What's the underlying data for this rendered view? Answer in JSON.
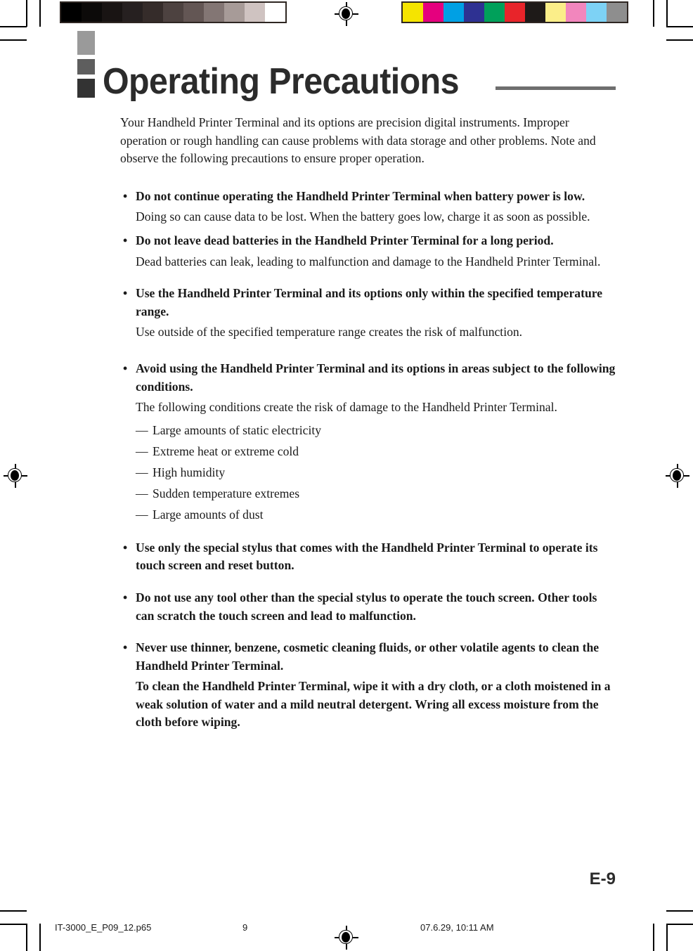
{
  "document": {
    "title": "Operating Precautions",
    "folio": "E-9"
  },
  "intro": "Your Handheld Printer Terminal and its options are precision digital instruments. Improper operation or rough handling can cause problems with data storage and other problems. Note and observe the following precautions to ensure proper operation.",
  "bullets": [
    {
      "marker": "•",
      "heading": "Do not continue operating the Handheld Printer Terminal when battery power is low.",
      "body": "Doing so can cause data to be lost. When the battery goes low, charge it as soon as possible.",
      "body_bold": false
    },
    {
      "marker": "•",
      "heading": "Do not leave dead batteries in the Handheld Printer Terminal for a long period.",
      "body": "Dead batteries can leak, leading to malfunction and damage to the Handheld Printer Terminal.",
      "body_bold": false
    },
    {
      "marker": "•",
      "heading": "Use the Handheld Printer Terminal and its options only within the specified temperature range.",
      "body": "Use outside of the specified temperature range creates the risk of malfunction.",
      "body_bold": false
    },
    {
      "marker": "•",
      "heading": "Avoid using the Handheld Printer Terminal and its options in areas subject to the following conditions.",
      "body": "The following conditions create the risk of damage to the Handheld Printer Terminal.",
      "body_bold": false,
      "sub_items": [
        "Large amounts of static electricity",
        "Extreme heat or extreme cold",
        "High humidity",
        "Sudden temperature extremes",
        "Large amounts of dust"
      ],
      "sub_marker": "—"
    },
    {
      "marker": "•",
      "heading": "Use only the special stylus that comes with the Handheld Printer Terminal to operate its touch screen and reset button.",
      "body": "",
      "body_bold": false
    },
    {
      "marker": "•",
      "heading": "Do not use any tool other than the special stylus to operate the touch screen. Other tools can scratch the touch screen and lead to malfunction.",
      "body": "",
      "body_bold": false
    },
    {
      "marker": "•",
      "heading": "Never use thinner, benzene, cosmetic cleaning fluids, or other volatile agents to clean the Handheld Printer Terminal.",
      "body": "To clean the Handheld Printer Terminal, wipe it with a dry cloth, or a cloth moistened in a weak solution of water and a mild neutral detergent. Wring all excess moisture from the cloth before wiping.",
      "body_bold": true
    }
  ],
  "slug": {
    "file": "IT-3000_E_P09_12.p65",
    "page": "9",
    "date": "07.6.29, 10:11 AM"
  },
  "press_marks": {
    "grayscale_strip": [
      "#000000",
      "#0c0a09",
      "#191413",
      "#262020",
      "#352c2a",
      "#4d4240",
      "#635654",
      "#837674",
      "#a79b98",
      "#cfc3c1",
      "#ffffff"
    ],
    "color_strip": [
      "#f5e400",
      "#e5007e",
      "#00a0e4",
      "#2e3192",
      "#00a05a",
      "#e8242a",
      "#1e1a18",
      "#fbee89",
      "#f286bd",
      "#7dd2f5",
      "#8e8e8e"
    ],
    "title_blocks": [
      "#9a9a9a",
      "#5e5e5e",
      "#333333"
    ],
    "title_rule_color": "#6e6e6e"
  }
}
